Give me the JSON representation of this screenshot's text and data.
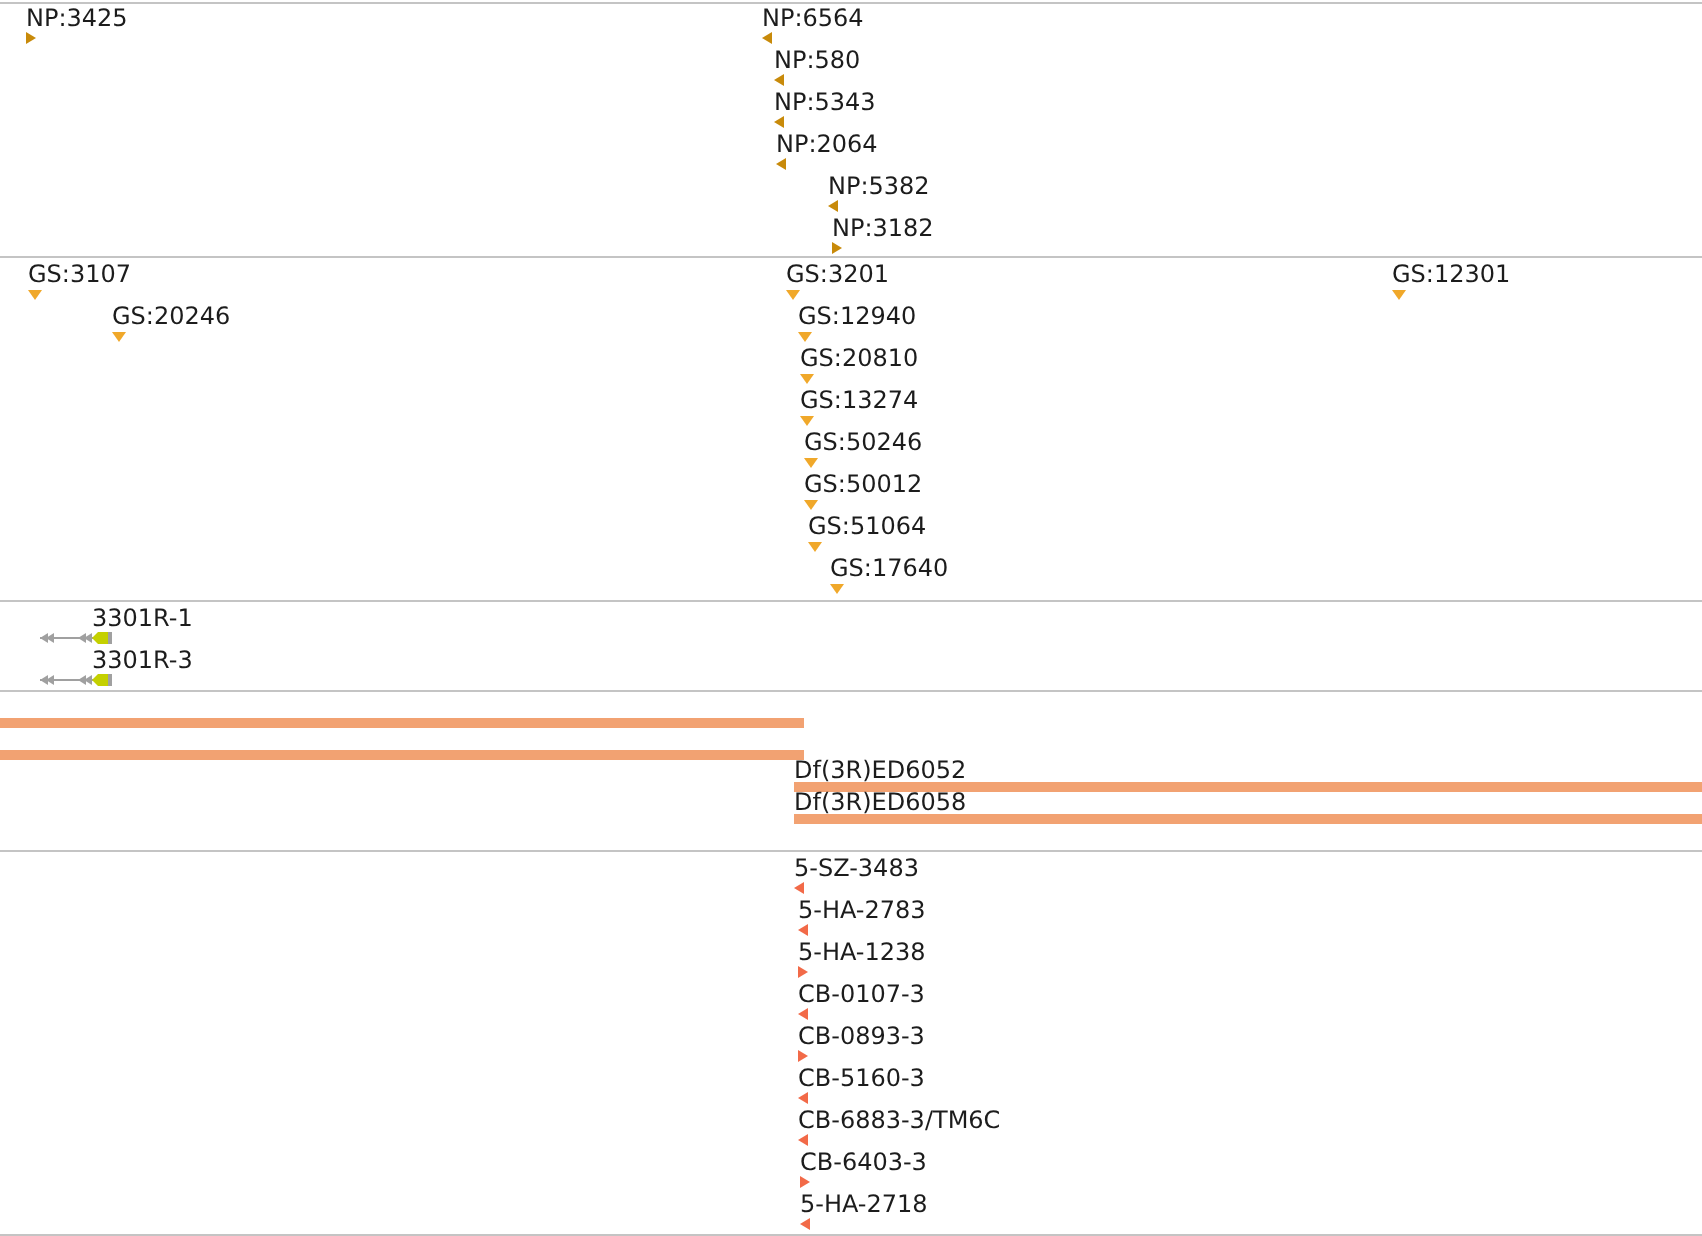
{
  "tracks": [
    {
      "kind": "point",
      "color": "#c88a0a",
      "features": [
        {
          "label": "NP:3425",
          "kind": "right"
        },
        {
          "label": "NP:6564",
          "kind": "left"
        },
        {
          "label": "NP:580",
          "kind": "left"
        },
        {
          "label": "NP:5343",
          "kind": "left"
        },
        {
          "label": "NP:2064",
          "kind": "left"
        },
        {
          "label": "NP:5382",
          "kind": "left"
        },
        {
          "label": "NP:3182",
          "kind": "right"
        }
      ]
    },
    {
      "kind": "point",
      "color": "#f0a82a",
      "features": [
        {
          "label": "GS:3107",
          "kind": "down"
        },
        {
          "label": "GS:3201",
          "kind": "down"
        },
        {
          "label": "GS:12301",
          "kind": "down"
        },
        {
          "label": "GS:20246",
          "kind": "down"
        },
        {
          "label": "GS:12940",
          "kind": "down"
        },
        {
          "label": "GS:20810",
          "kind": "down"
        },
        {
          "label": "GS:13274",
          "kind": "down"
        },
        {
          "label": "GS:50246",
          "kind": "down"
        },
        {
          "label": "GS:50012",
          "kind": "down"
        },
        {
          "label": "GS:51064",
          "kind": "down"
        },
        {
          "label": "GS:17640",
          "kind": "down"
        }
      ]
    },
    {
      "kind": "gene",
      "features": [
        {
          "label": "3301R-1"
        },
        {
          "label": "3301R-3"
        }
      ]
    },
    {
      "kind": "span",
      "color": "#f2a272",
      "features": [
        {
          "kind": "plain"
        },
        {
          "kind": "plain"
        },
        {
          "kind": "labeled",
          "label": "Df(3R)ED6052"
        },
        {
          "kind": "labeled",
          "label": "Df(3R)ED6058"
        }
      ]
    },
    {
      "kind": "point",
      "color": "#f26a48",
      "features": [
        {
          "label": "5-SZ-3483",
          "kind": "left"
        },
        {
          "label": "5-HA-2783",
          "kind": "left"
        },
        {
          "label": "5-HA-1238",
          "kind": "right"
        },
        {
          "label": "CB-0107-3",
          "kind": "left"
        },
        {
          "label": "CB-0893-3",
          "kind": "right"
        },
        {
          "label": "CB-5160-3",
          "kind": "left"
        },
        {
          "label": "CB-6883-3/TM6C",
          "kind": "left"
        },
        {
          "label": "CB-6403-3",
          "kind": "right"
        },
        {
          "label": "5-HA-2718",
          "kind": "left"
        }
      ]
    }
  ]
}
